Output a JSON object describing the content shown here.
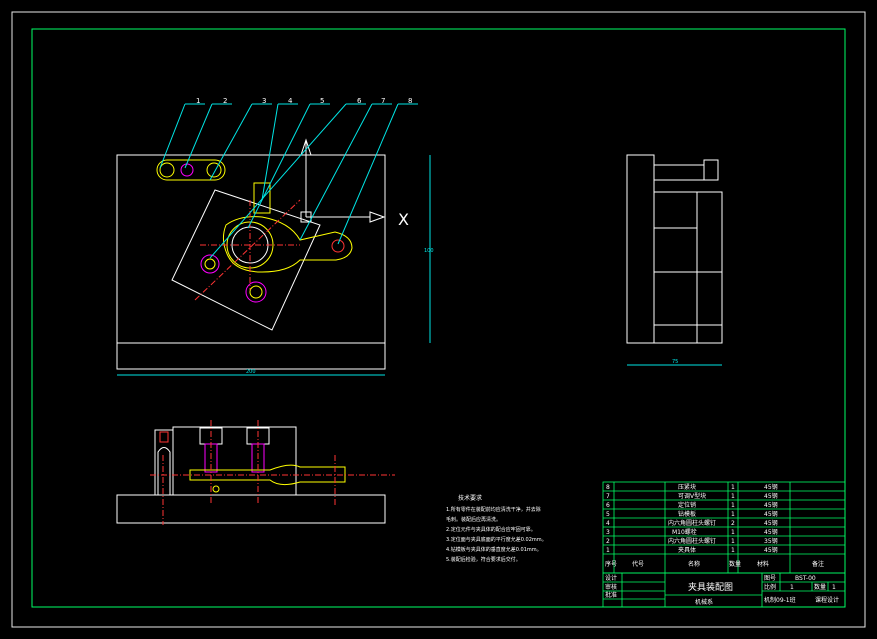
{
  "balloons": [
    "1",
    "2",
    "3",
    "4",
    "5",
    "6",
    "7",
    "8"
  ],
  "axis_label": "X",
  "dims": {
    "top_width": "200",
    "top_height": "100",
    "side_width": "75"
  },
  "notes": {
    "title": "技术要求",
    "lines": [
      "1.所有零件在装配前均应清洗干净，并去除",
      "  毛刺。装配后应再清洗。",
      "2.定位元件与夹具体的配合应牢固可靠。",
      "3.定位面与夹具底面的平行度允差0.02mm。",
      "4.钻模板与夹具体的垂直度允差0.01mm。",
      "5.装配后检验，符合要求后交付。"
    ]
  },
  "parts_list": {
    "rows": [
      {
        "no": "8",
        "name": "压紧块",
        "qty": "1",
        "material": "45钢"
      },
      {
        "no": "7",
        "name": "可调V型块",
        "qty": "1",
        "material": "45钢"
      },
      {
        "no": "6",
        "name": "定位销",
        "qty": "1",
        "material": "45钢"
      },
      {
        "no": "5",
        "name": "钻模板",
        "qty": "1",
        "material": "45钢"
      },
      {
        "no": "4",
        "name": "内六角圆柱头螺钉",
        "qty": "2",
        "material": "45钢"
      },
      {
        "no": "3",
        "name": "M10螺栓",
        "qty": "1",
        "material": "45钢"
      },
      {
        "no": "2",
        "name": "内六角圆柱头螺钉",
        "qty": "1",
        "material": "35钢"
      },
      {
        "no": "1",
        "name": "夹具体",
        "qty": "1",
        "material": "45钢"
      }
    ],
    "header": {
      "no": "序号",
      "code": "代号",
      "name": "名称",
      "qty": "数量",
      "material": "材料",
      "remark": "备注"
    }
  },
  "title_block": {
    "title": "夹具装配图",
    "designed_label": "设计",
    "checked_label": "审核",
    "approved_label": "批准",
    "drawing_no_label": "图号",
    "drawing_no": "BST-00",
    "ratio_label": "比例",
    "ratio": "1",
    "qty_label": "数量",
    "qty": "1",
    "class_label": "机制09-1班",
    "unit": "机械系",
    "school": "课程设计"
  },
  "colors": {
    "background": "#000000",
    "border": "#00ff66",
    "outline": "#ffffff",
    "part": "#ffff00",
    "center": "#ff3333",
    "accent": "#ff00ff",
    "dimension": "#00e5e5",
    "leader": "#00e5e5"
  }
}
